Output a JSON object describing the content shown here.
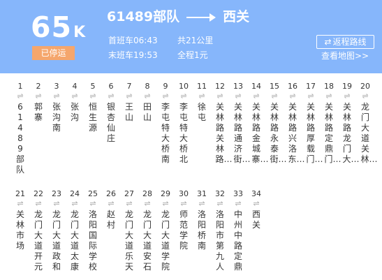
{
  "route": {
    "number": "65",
    "suffix": "K",
    "status": "已停运"
  },
  "direction": {
    "from": "61489部队",
    "to": "西关"
  },
  "schedule": {
    "first_bus": "首班车06:43",
    "last_bus": "末班车19:53"
  },
  "meta": {
    "distance": "共21公里",
    "fare": "全程1元"
  },
  "actions": {
    "reverse_icon": "⇄",
    "reverse_label": "返程路线",
    "map_label": "查看地图>>"
  },
  "stops": [
    {
      "num": "1",
      "name": "61489部队"
    },
    {
      "num": "2",
      "name": "郭寨"
    },
    {
      "num": "3",
      "name": "张沟南"
    },
    {
      "num": "4",
      "name": "张沟"
    },
    {
      "num": "5",
      "name": "恒生源"
    },
    {
      "num": "6",
      "name": "银杏仙庄"
    },
    {
      "num": "7",
      "name": "王山"
    },
    {
      "num": "8",
      "name": "田山"
    },
    {
      "num": "9",
      "name": "李屯特大桥南"
    },
    {
      "num": "10",
      "name": "李屯特大桥北"
    },
    {
      "num": "11",
      "name": "徐屯"
    },
    {
      "num": "12",
      "name": "关林路关林路…"
    },
    {
      "num": "13",
      "name": "关林路通济街…"
    },
    {
      "num": "14",
      "name": "关林路金城寨…"
    },
    {
      "num": "15",
      "name": "关林路永泰街…"
    },
    {
      "num": "16",
      "name": "关林路兴洛东…"
    },
    {
      "num": "17",
      "name": "关林路厚载门…"
    },
    {
      "num": "18",
      "name": "关林路定鼎门…"
    },
    {
      "num": "19",
      "name": "关林路龙门大…"
    },
    {
      "num": "20",
      "name": "龙门大道关林…"
    },
    {
      "num": "21",
      "name": "关林市场"
    },
    {
      "num": "22",
      "name": "龙门大道开元"
    },
    {
      "num": "23",
      "name": "龙门大道政和"
    },
    {
      "num": "24",
      "name": "龙门大道太康"
    },
    {
      "num": "25",
      "name": "洛阳国际学校"
    },
    {
      "num": "26",
      "name": "赵村"
    },
    {
      "num": "27",
      "name": "龙门大道乐天"
    },
    {
      "num": "28",
      "name": "龙门大道安石"
    },
    {
      "num": "29",
      "name": "龙门大道学院"
    },
    {
      "num": "30",
      "name": "师范学院"
    },
    {
      "num": "31",
      "name": "洛阳桥南"
    },
    {
      "num": "32",
      "name": "洛阳市第九人"
    },
    {
      "num": "33",
      "name": "中州中路定鼎"
    },
    {
      "num": "34",
      "name": "西关"
    }
  ]
}
